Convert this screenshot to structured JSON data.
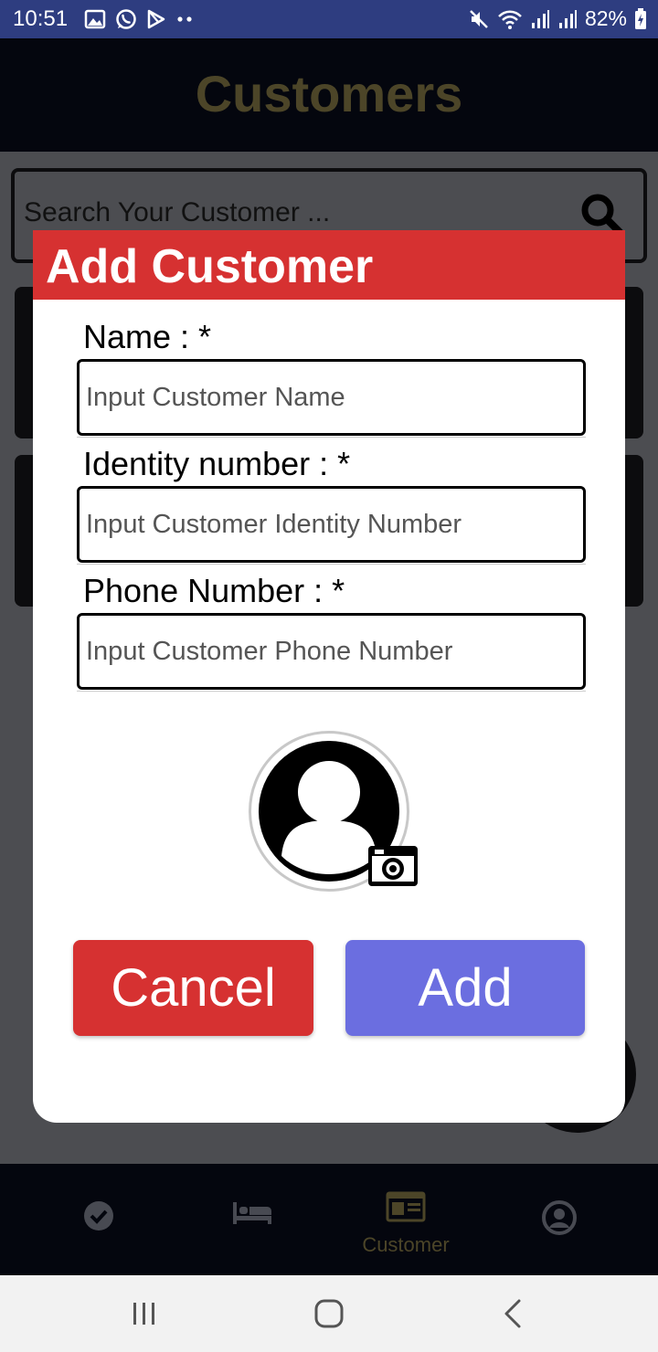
{
  "status_bar": {
    "time": "10:51",
    "battery": "82%"
  },
  "app": {
    "title": "Customers"
  },
  "search": {
    "placeholder": "Search Your Customer ..."
  },
  "bottom_nav": {
    "items": [
      {
        "icon": "check-circle-icon",
        "label": ""
      },
      {
        "icon": "bed-icon",
        "label": ""
      },
      {
        "icon": "id-card-icon",
        "label": "Customer",
        "active": true
      },
      {
        "icon": "account-circle-icon",
        "label": ""
      }
    ]
  },
  "modal": {
    "title": "Add Customer",
    "fields": [
      {
        "label": "Name : *",
        "placeholder": "Input Customer Name",
        "value": ""
      },
      {
        "label": "Identity number : *",
        "placeholder": "Input Customer Identity Number",
        "value": ""
      },
      {
        "label": "Phone Number : *",
        "placeholder": "Input Customer Phone Number",
        "value": ""
      }
    ],
    "cancel_label": "Cancel",
    "add_label": "Add"
  },
  "colors": {
    "status_bar": "#2e3d80",
    "modal_header": "#d63131",
    "cancel_button": "#d63131",
    "add_button": "#6b6ee0",
    "accent_dimmed": "#4c4528"
  }
}
